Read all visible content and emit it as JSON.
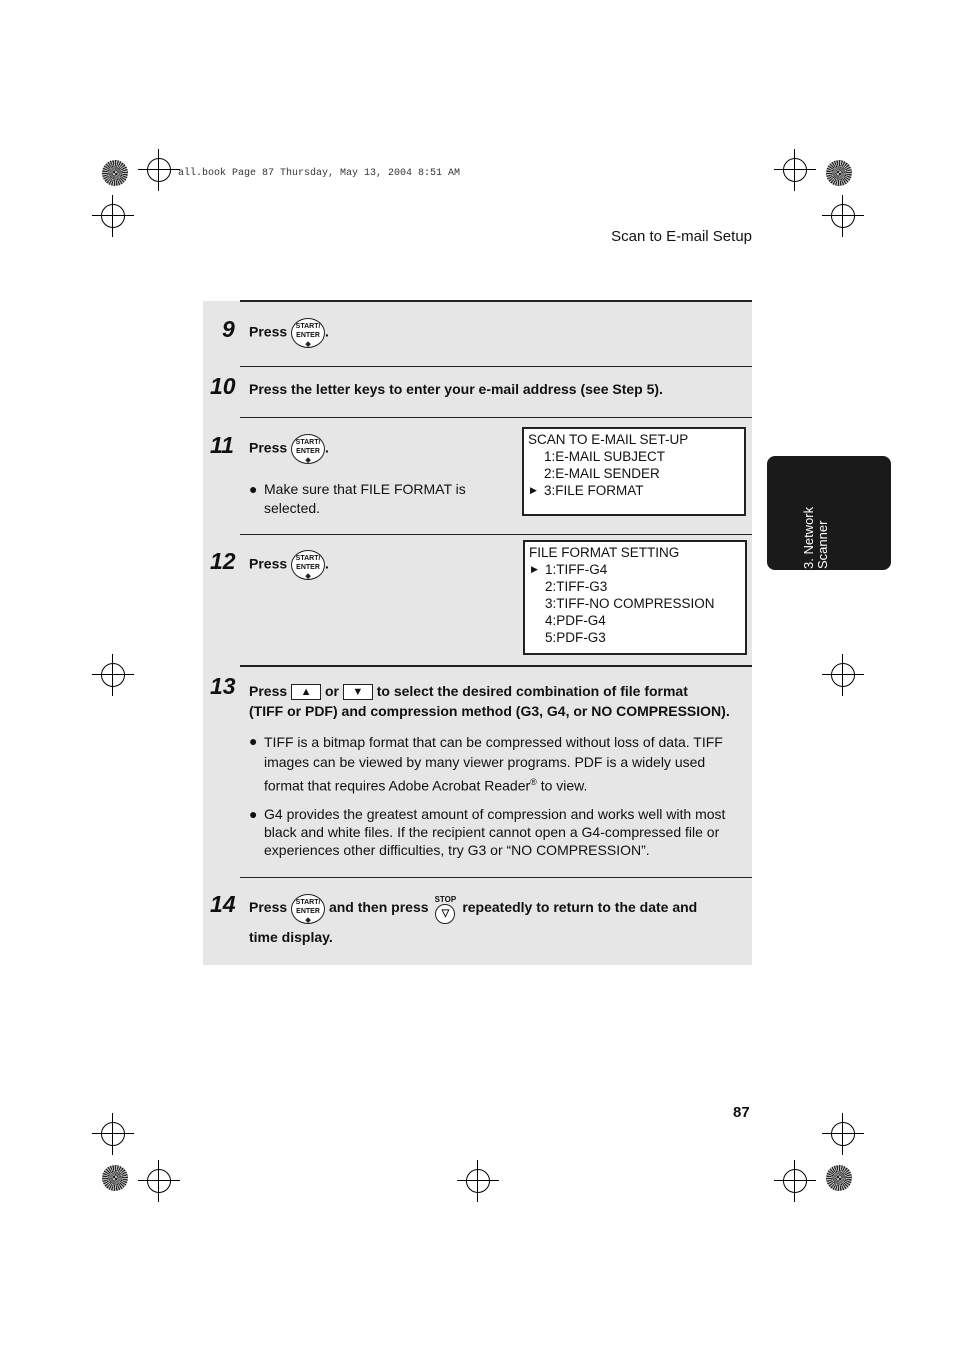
{
  "print_header": "all.book  Page 87  Thursday, May 13, 2004  8:51 AM",
  "section_title": "Scan to E-mail Setup",
  "side_tab": {
    "line1": "3. Network",
    "line2": "Scanner"
  },
  "key_start": {
    "l1": "START/",
    "l2": "ENTER",
    "l3": "◈"
  },
  "key_stop": "STOP",
  "steps": {
    "s9": {
      "num": "9",
      "press": "Press",
      "end": "."
    },
    "s10": {
      "num": "10",
      "text": "Press the letter keys to enter your e-mail address (see Step 5)."
    },
    "s11": {
      "num": "11",
      "press": "Press",
      "end": ".",
      "bullet": "Make sure that FILE FORMAT is selected.",
      "lcd": [
        "SCAN TO E-MAIL SET-UP",
        "1:E-MAIL SUBJECT",
        "2:E-MAIL SENDER",
        "3:FILE FORMAT"
      ]
    },
    "s12": {
      "num": "12",
      "press": "Press",
      "end": ".",
      "lcd": [
        "FILE FORMAT SETTING",
        "1:TIFF-G4",
        "2:TIFF-G3",
        "3:TIFF-NO COMPRESSION",
        "4:PDF-G4",
        "5:PDF-G3"
      ]
    },
    "s13": {
      "num": "13",
      "press": "Press",
      "or": "or",
      "rest": "to select the desired combination of file format",
      "line2": "(TIFF or PDF) and compression method (G3, G4, or NO COMPRESSION).",
      "bullet1a": "TIFF is a bitmap format that can be compressed without loss of data. TIFF images can be viewed by many viewer programs. PDF is a widely used format that requires Adobe Acrobat Reader",
      "reg": "®",
      "bullet1b": " to view.",
      "bullet2": "G4 provides the greatest amount of compression and works well with most black and white files. If the recipient cannot open a G4-compressed file or experiences other difficulties, try G3 or “NO COMPRESSION”."
    },
    "s14": {
      "num": "14",
      "press": "Press",
      "mid": "and then press",
      "rest": "repeatedly to return to the date and",
      "line2": "time display."
    }
  },
  "page_number": "87"
}
